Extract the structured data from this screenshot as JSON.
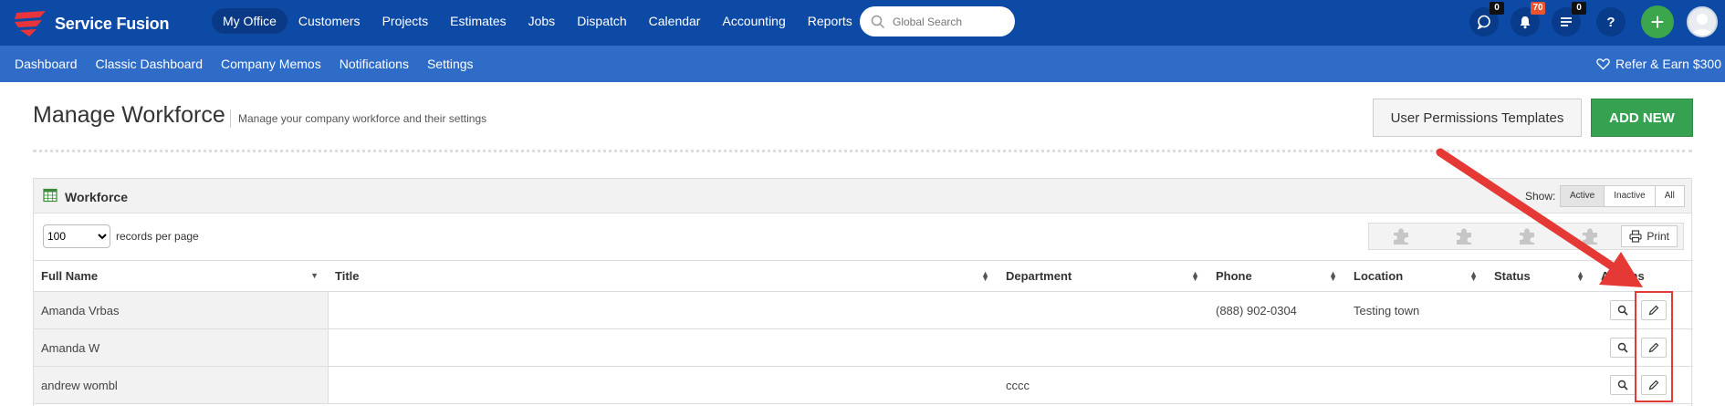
{
  "app": {
    "name": "Service Fusion"
  },
  "main_nav": [
    "My Office",
    "Customers",
    "Projects",
    "Estimates",
    "Jobs",
    "Dispatch",
    "Calendar",
    "Accounting",
    "Reports"
  ],
  "search": {
    "placeholder": "Global Search"
  },
  "badges": {
    "chat": "0",
    "notifications": "70",
    "tasks": "0"
  },
  "help_label": "?",
  "sub_nav": [
    "Dashboard",
    "Classic Dashboard",
    "Company Memos",
    "Notifications",
    "Settings"
  ],
  "refer": "Refer & Earn $300",
  "page": {
    "title": "Manage Workforce",
    "subtitle": "Manage your company workforce and their settings"
  },
  "buttons": {
    "permissions": "User Permissions Templates",
    "add_new": "ADD NEW",
    "print": "Print"
  },
  "panel": {
    "title": "Workforce",
    "show_label": "Show:",
    "filters": [
      "Active",
      "Inactive",
      "All"
    ]
  },
  "per_page": {
    "value": "100",
    "label": "records per page"
  },
  "table": {
    "headers": [
      "Full Name",
      "Title",
      "Department",
      "Phone",
      "Location",
      "Status",
      "Actions"
    ],
    "rows": [
      {
        "name": "Amanda Vrbas",
        "title": "",
        "department": "",
        "phone": "(888) 902-0304",
        "location": "Testing town",
        "status": ""
      },
      {
        "name": "Amanda W",
        "title": "",
        "department": "",
        "phone": "",
        "location": "",
        "status": ""
      },
      {
        "name": "andrew wombl",
        "title": "",
        "department": "cccc",
        "phone": "",
        "location": "",
        "status": ""
      }
    ]
  },
  "colors": {
    "topbar": "#0d4aa6",
    "subbar": "#2e6cc7",
    "add_button": "#36a150",
    "annotation": "#e53935"
  }
}
